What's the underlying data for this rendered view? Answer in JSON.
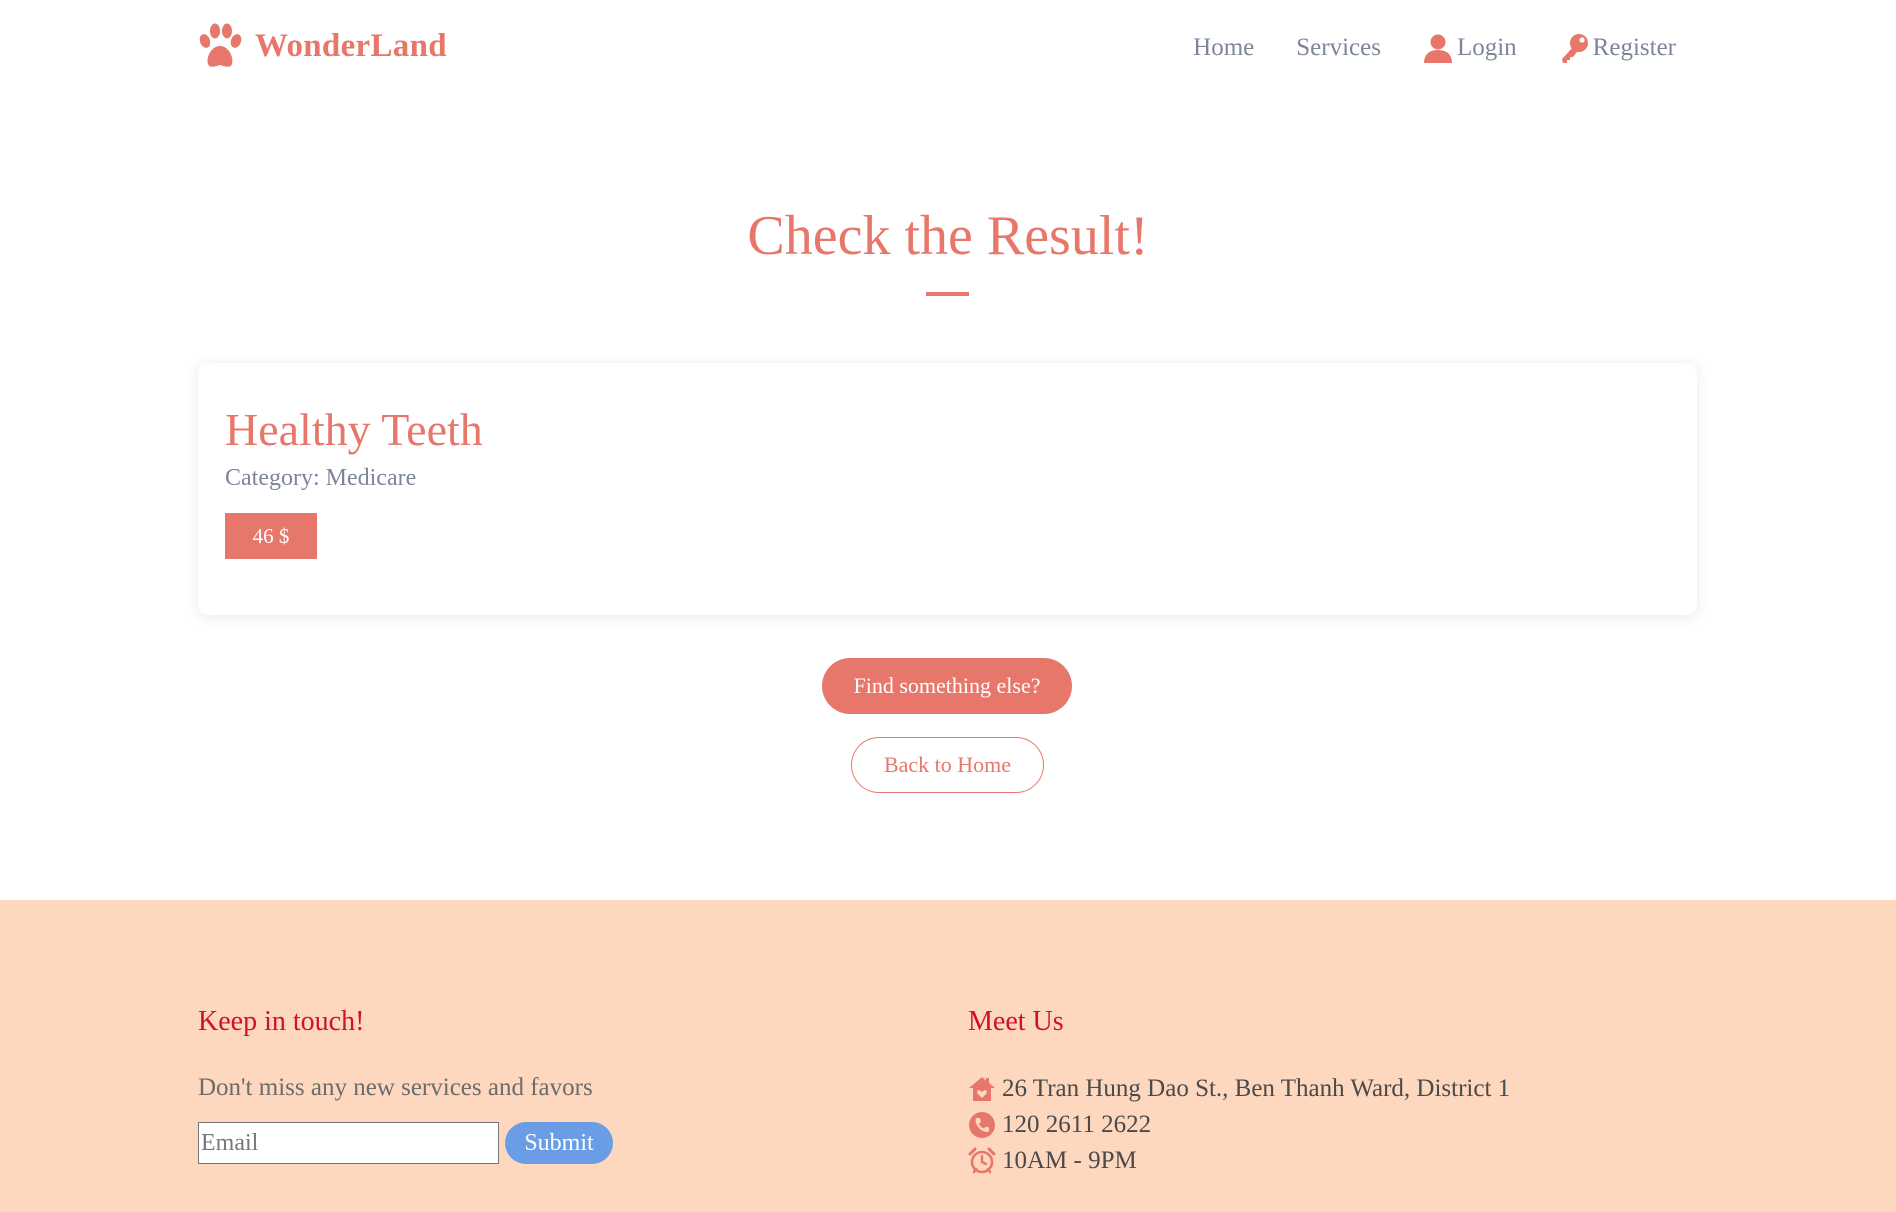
{
  "header": {
    "brand": "WonderLand",
    "nav": [
      {
        "label": "Home",
        "icon": null
      },
      {
        "label": "Services",
        "icon": null
      },
      {
        "label": "Login",
        "icon": "user-icon"
      },
      {
        "label": "Register",
        "icon": "key-icon"
      }
    ]
  },
  "main": {
    "title": "Check the Result!",
    "result": {
      "name": "Healthy Teeth",
      "category": "Category: Medicare",
      "price": "46 $"
    },
    "find_button": "Find something else?",
    "home_button": "Back to Home"
  },
  "footer": {
    "newsletter": {
      "heading": "Keep in touch!",
      "text": "Don't miss any new services and favors",
      "email_placeholder": "Email",
      "email_value": "",
      "submit": "Submit"
    },
    "contact": {
      "heading": "Meet Us",
      "address": "26 Tran Hung Dao St., Ben Thanh Ward, District 1",
      "phone": "120 2611 2622",
      "hours": "10AM - 9PM"
    }
  },
  "colors": {
    "accent": "#e8776b",
    "nav_text": "#7d8699",
    "footer_bg": "#fed7bf",
    "footer_heading": "#d0102c",
    "submit_button": "#6a9de6"
  }
}
